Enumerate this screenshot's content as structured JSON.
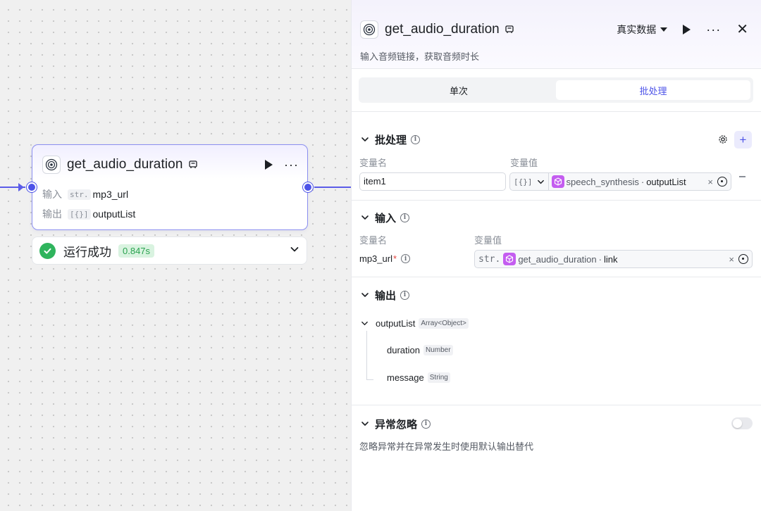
{
  "canvas": {
    "node": {
      "title": "get_audio_duration",
      "input_label": "输入",
      "input_type": "str.",
      "input_value": "mp3_url",
      "output_label": "输出",
      "output_type": "[{}]",
      "output_value": "outputList"
    },
    "run_status": {
      "text": "运行成功",
      "time": "0.847s"
    }
  },
  "panel": {
    "title": "get_audio_duration",
    "data_mode": "真实数据",
    "description": "输入音频链接，获取音频时长",
    "tabs": [
      {
        "label": "单次",
        "active": false
      },
      {
        "label": "批处理",
        "active": true
      }
    ],
    "batch": {
      "title": "批处理",
      "col_name": "变量名",
      "col_value": "变量值",
      "var_name": "item1",
      "value_type": "[{}]",
      "ref_node": "speech_synthesis",
      "ref_var": "outputList",
      "clear": "×"
    },
    "input": {
      "title": "输入",
      "col_name": "变量名",
      "col_value": "变量值",
      "param_name": "mp3_url",
      "required_mark": "*",
      "value_type": "str.",
      "ref_node": "get_audio_duration",
      "ref_var": "link",
      "clear": "×"
    },
    "output": {
      "title": "输出",
      "root_name": "outputList",
      "root_type": "Array<Object>",
      "children": [
        {
          "name": "duration",
          "type": "Number"
        },
        {
          "name": "message",
          "type": "String"
        }
      ]
    },
    "exception": {
      "title": "异常忽略",
      "description": "忽略异常并在异常发生时使用默认输出替代",
      "enabled": false
    }
  },
  "colors": {
    "accent": "#4d53e8",
    "success": "#2fb45d",
    "plugin_cube": "#c45df0"
  }
}
